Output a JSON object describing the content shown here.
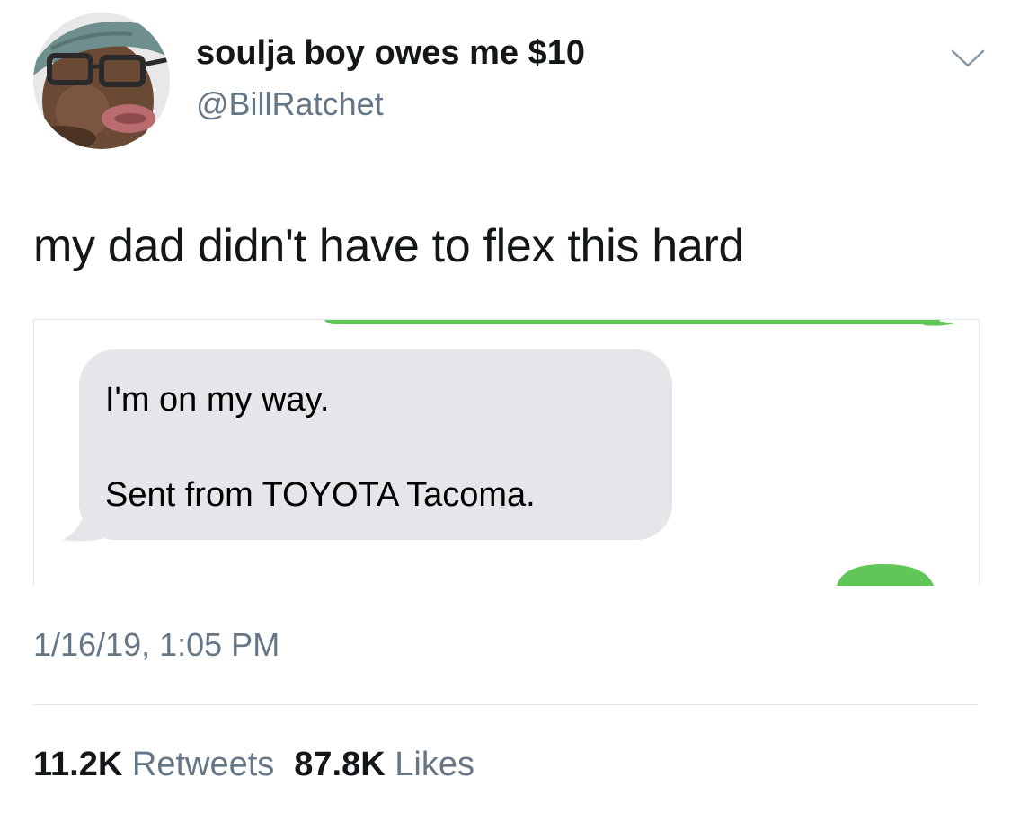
{
  "tweet": {
    "author": {
      "display_name": "soulja boy owes me $10",
      "handle": "@BillRatchet",
      "avatar_icon": "profile-photo"
    },
    "menu_icon": "chevron-down-icon",
    "text": "my dad didn't have to flex this hard",
    "media": {
      "message_line_1": "I'm on my way.",
      "message_line_2": "Sent from TOYOTA Tacoma.",
      "received_bubble_color": "#e5e5ea",
      "sent_bubble_color": "#5fc657"
    },
    "timestamp": "1/16/19, 1:05 PM",
    "stats": {
      "retweets_count": "11.2K",
      "retweets_label": "Retweets",
      "likes_count": "87.8K",
      "likes_label": "Likes"
    }
  },
  "colors": {
    "text_primary": "#14171a",
    "text_secondary": "#657786",
    "divider": "#e1e8ed"
  }
}
